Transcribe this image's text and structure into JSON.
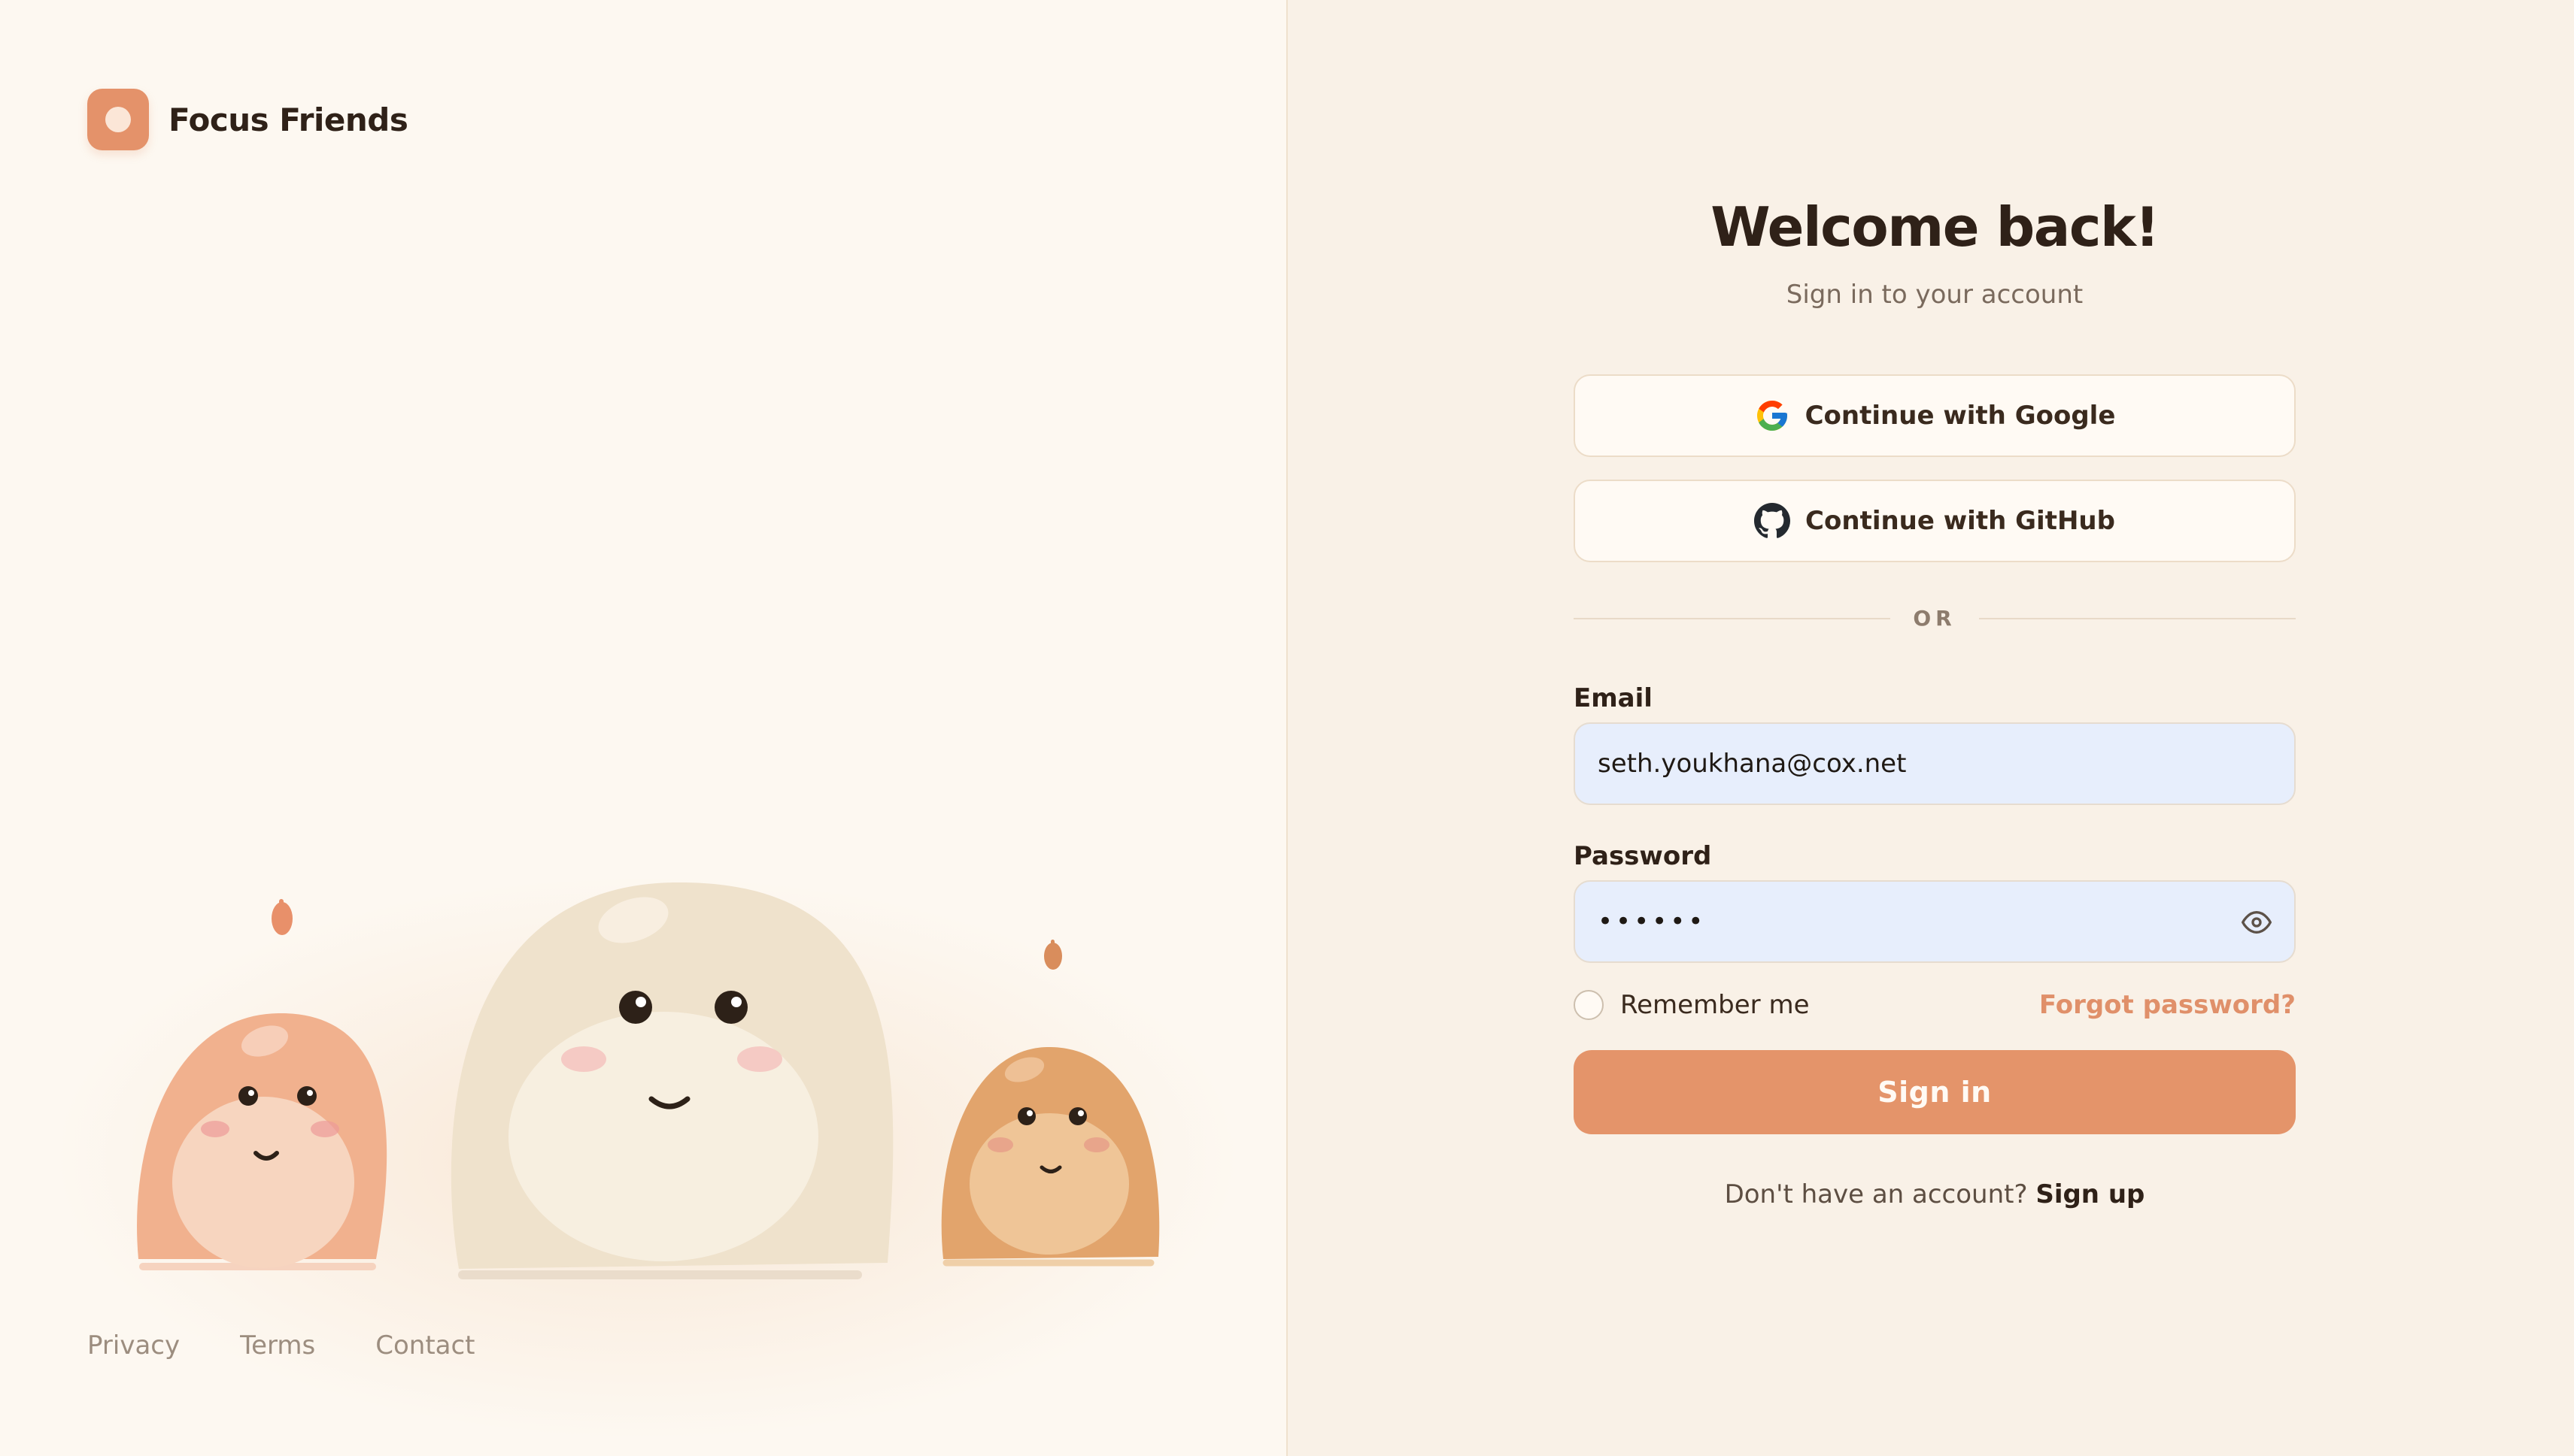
{
  "brand": {
    "name": "Focus Friends"
  },
  "footer": {
    "links": [
      "Privacy",
      "Terms",
      "Contact"
    ]
  },
  "login": {
    "title": "Welcome back!",
    "subtitle": "Sign in to your account",
    "google_label": "Continue with Google",
    "github_label": "Continue with GitHub",
    "divider": "OR",
    "email_label": "Email",
    "email_value": "seth.youkhana@cox.net",
    "password_label": "Password",
    "password_value": "••••••",
    "remember_label": "Remember me",
    "forgot_label": "Forgot password?",
    "signin_label": "Sign in",
    "signup_prompt": "Don't have an account?",
    "signup_link": "Sign up"
  },
  "colors": {
    "accent": "#e4946a",
    "left_bg": "#fdf8f1",
    "right_bg": "#f9f1e7",
    "field_bg": "#e7eefc"
  },
  "icons": [
    "logo-icon",
    "google-icon",
    "github-icon",
    "eye-icon"
  ]
}
